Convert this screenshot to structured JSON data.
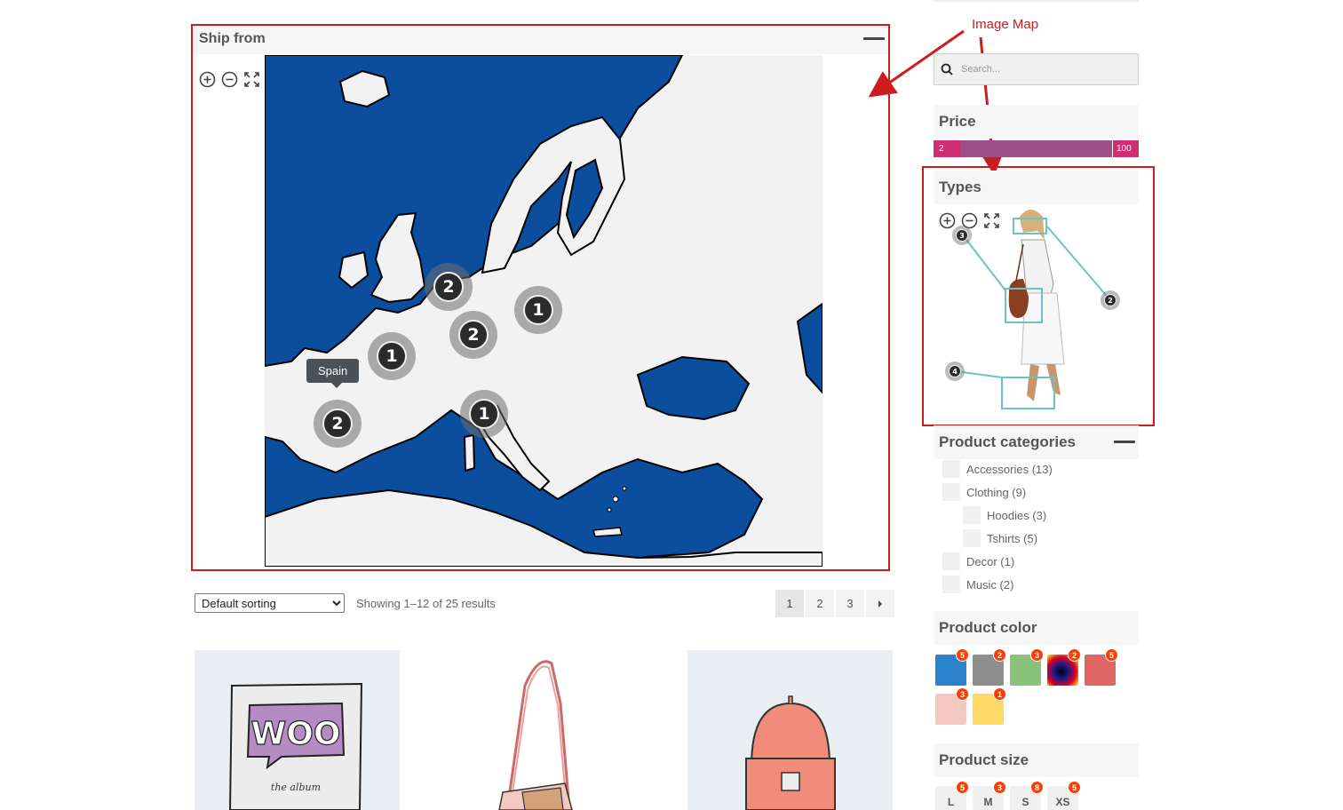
{
  "ship_from": {
    "title": "Ship from",
    "clusters": [
      {
        "id": "cluster-uk",
        "count": "2"
      },
      {
        "id": "cluster-benelux",
        "count": "2"
      },
      {
        "id": "cluster-germany",
        "count": "1"
      },
      {
        "id": "cluster-france",
        "count": "1"
      },
      {
        "id": "cluster-spain",
        "count": "2"
      },
      {
        "id": "cluster-italy",
        "count": "1"
      }
    ],
    "tooltip": "Spain"
  },
  "annotation": {
    "label": "Image Map",
    "color": "#cc1c1c"
  },
  "toolbar": {
    "sort_selected": "Default sorting",
    "sort_options": [
      "Default sorting"
    ],
    "result_count": "Showing 1–12 of 25 results",
    "pages": [
      "1",
      "2",
      "3"
    ],
    "next_icon": "chevron-right-icon"
  },
  "sidebar": {
    "search_placeholder": "Search...",
    "price": {
      "title": "Price",
      "min": "2",
      "max": "100"
    },
    "types": {
      "title": "Types",
      "hotspots": [
        "3",
        "2",
        "4"
      ]
    },
    "categories": {
      "title": "Product categories",
      "items": [
        {
          "label": "Accessories (13)"
        },
        {
          "label": "Clothing (9)"
        },
        {
          "label": "Hoodies (3)"
        },
        {
          "label": "Tshirts (5)"
        },
        {
          "label": "Decor (1)"
        },
        {
          "label": "Music (2)"
        }
      ]
    },
    "color": {
      "title": "Product color",
      "swatches": [
        {
          "color": "#2d82cc",
          "count": "5"
        },
        {
          "color": "#8e8e8e",
          "count": "2"
        },
        {
          "color": "#8bc27a",
          "count": "3"
        },
        {
          "color": "gradient",
          "count": "2"
        },
        {
          "color": "#e06666",
          "count": "5"
        },
        {
          "color": "#f4c7c3",
          "count": "3"
        },
        {
          "color": "#ffd966",
          "count": "1"
        }
      ]
    },
    "size": {
      "title": "Product size",
      "items": [
        {
          "label": "L",
          "count": "5"
        },
        {
          "label": "M",
          "count": "3"
        },
        {
          "label": "S",
          "count": "8"
        },
        {
          "label": "XS",
          "count": "5"
        }
      ]
    }
  },
  "products": {
    "album_text": "WOO",
    "album_subtitle": "the album"
  }
}
